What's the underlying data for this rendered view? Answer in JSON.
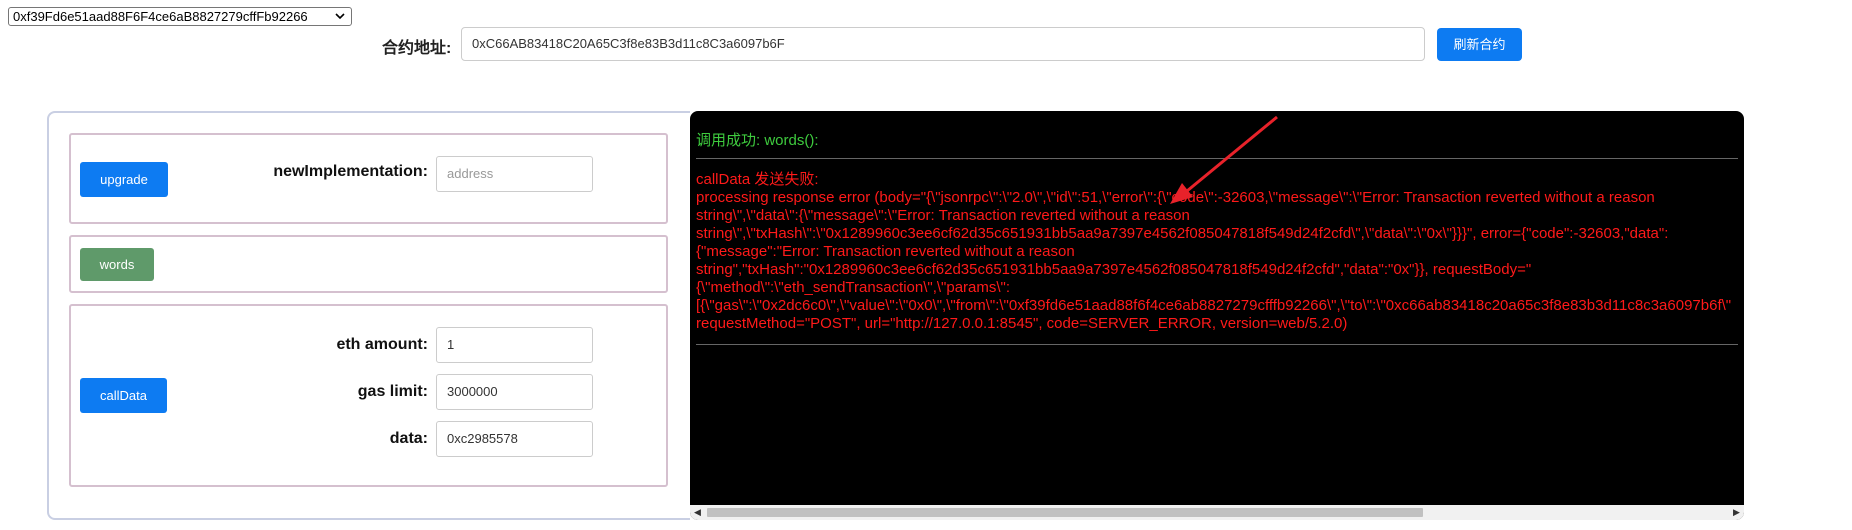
{
  "account_select": {
    "selected": "0xf39Fd6e51aad88F6F4ce6aB8827279cffFb92266"
  },
  "contract": {
    "label": "合约地址:",
    "address": "0xC66AB83418C20A65C3f8e83B3d11c8C3a6097b6F",
    "refresh_label": "刷新合约"
  },
  "functions": {
    "upgrade": {
      "button_label": "upgrade",
      "param_label": "newImplementation:",
      "param_placeholder": "address"
    },
    "words": {
      "button_label": "words"
    },
    "calldata": {
      "button_label": "callData",
      "eth_amount_label": "eth amount:",
      "eth_amount_value": "1",
      "gas_limit_label": "gas limit:",
      "gas_limit_value": "3000000",
      "data_label": "data:",
      "data_value": "0xc2985578"
    }
  },
  "console": {
    "success_line": "调用成功: words():",
    "error_lines": [
      "callData 发送失败:",
      "processing response error (body=\"{\\\"jsonrpc\\\":\\\"2.0\\\",\\\"id\\\":51,\\\"error\\\":{\\\"code\\\":-32603,\\\"message\\\":\\\"Error: Transaction reverted without a reason",
      "string\\\",\\\"data\\\":{\\\"message\\\":\\\"Error: Transaction reverted without a reason",
      "string\\\",\\\"txHash\\\":\\\"0x1289960c3ee6cf62d35c651931bb5aa9a7397e4562f085047818f549d24f2cfd\\\",\\\"data\\\":\\\"0x\\\"}}}\", error={\"code\":-32603,\"data\":",
      "{\"message\":\"Error: Transaction reverted without a reason",
      "string\",\"txHash\":\"0x1289960c3ee6cf62d35c651931bb5aa9a7397e4562f085047818f549d24f2cfd\",\"data\":\"0x\"}}, requestBody=\"",
      "{\\\"method\\\":\\\"eth_sendTransaction\\\",\\\"params\\\":",
      "[{\\\"gas\\\":\\\"0x2dc6c0\\\",\\\"value\\\":\\\"0x0\\\",\\\"from\\\":\\\"0xf39fd6e51aad88f6f4ce6ab8827279cfffb92266\\\",\\\"to\\\":\\\"0xc66ab83418c20a65c3f8e83b3d11c8c3a6097b6f\\\"",
      "requestMethod=\"POST\", url=\"http://127.0.0.1:8545\", code=SERVER_ERROR, version=web/5.2.0)"
    ]
  },
  "colors": {
    "primary_button": "#0d7bf2",
    "words_button": "#5f9a6a",
    "success_text": "#3ecb3e",
    "error_text": "#ff1a1a",
    "annotation_arrow": "#e8222a"
  },
  "icons": {
    "select_chevron": "chevron-down-icon",
    "scroll_left": "scroll-left-icon",
    "scroll_right": "scroll-right-icon",
    "annotation": "red-arrow-annotation"
  }
}
